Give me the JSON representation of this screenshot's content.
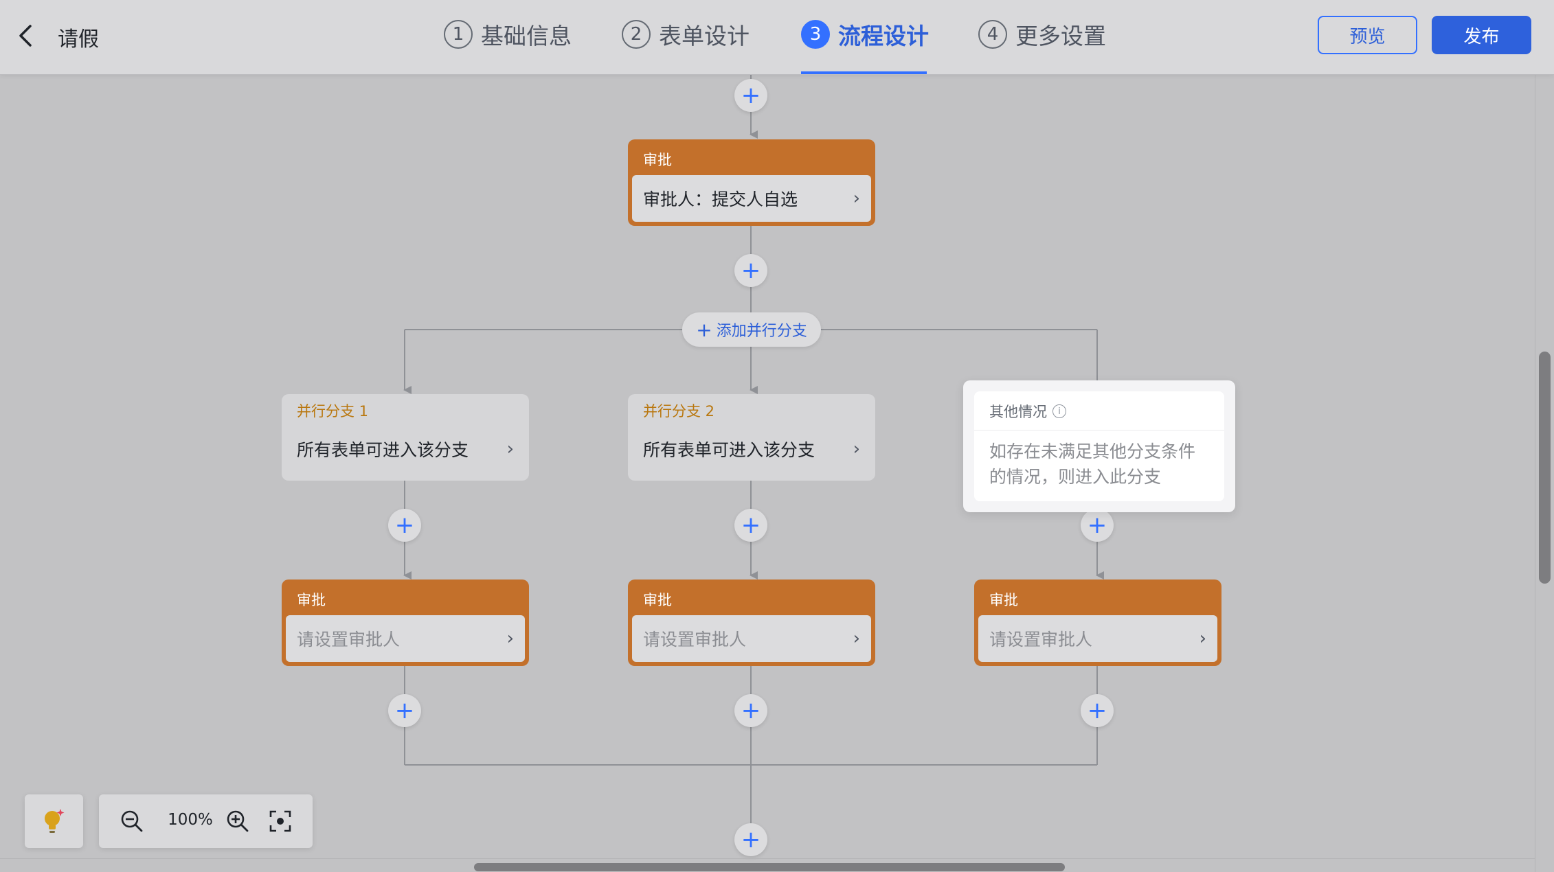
{
  "header": {
    "title": "请假",
    "steps": [
      {
        "num": "1",
        "label": "基础信息"
      },
      {
        "num": "2",
        "label": "表单设计"
      },
      {
        "num": "3",
        "label": "流程设计"
      },
      {
        "num": "4",
        "label": "更多设置"
      }
    ],
    "active_step": 3,
    "preview_label": "预览",
    "publish_label": "发布"
  },
  "flow": {
    "top_approval": {
      "title": "审批",
      "body": "审批人：提交人自选"
    },
    "add_parallel_label": "添加并行分支",
    "branches": [
      {
        "title": "并行分支 1",
        "body": "所有表单可进入该分支"
      },
      {
        "title": "并行分支 2",
        "body": "所有表单可进入该分支"
      }
    ],
    "other_branch": {
      "title": "其他情况",
      "desc_line1": "如存在未满足其他分支条件",
      "desc_line2": "的情况，则进入此分支"
    },
    "branch_approvals": [
      {
        "title": "审批",
        "body": "请设置审批人"
      },
      {
        "title": "审批",
        "body": "请设置审批人"
      },
      {
        "title": "审批",
        "body": "请设置审批人"
      }
    ]
  },
  "toolbar": {
    "zoom": "100%"
  },
  "colors": {
    "accent": "#3370ff",
    "approval_node": "#c3702b",
    "branch_title": "#b9770e",
    "canvas": "#c2c2c4"
  },
  "icons": [
    "back-arrow-icon",
    "plus-icon",
    "chevron-right-icon",
    "info-icon",
    "lightbulb-icon",
    "zoom-out-icon",
    "zoom-in-icon",
    "fit-screen-icon"
  ]
}
